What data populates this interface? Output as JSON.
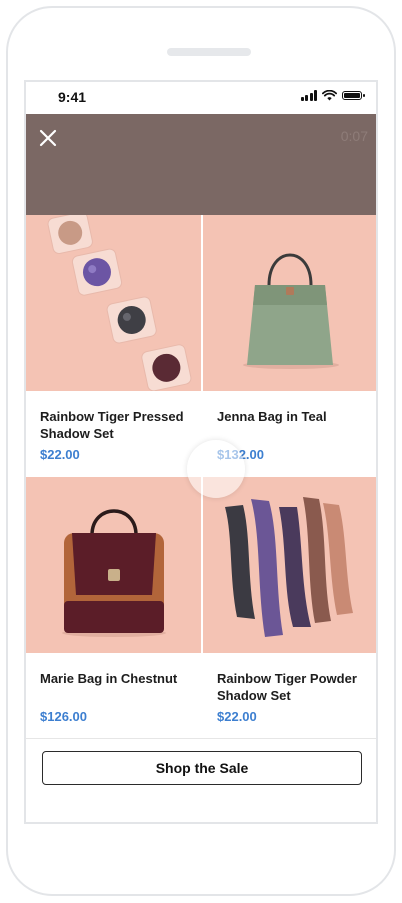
{
  "status_bar": {
    "time": "9:41"
  },
  "video": {
    "timer": "0:07"
  },
  "products": [
    {
      "name": "Rainbow Tiger Pressed Shadow Set",
      "price": "$22.00"
    },
    {
      "name": "Jenna Bag in Teal",
      "price": "$132.00"
    },
    {
      "name": "Marie Bag in Chestnut",
      "price": "$126.00"
    },
    {
      "name": "Rainbow Tiger Powder Shadow Set",
      "price": "$22.00"
    }
  ],
  "cta": {
    "label": "Shop the Sale"
  },
  "colors": {
    "accent_price": "#3d7fd0",
    "header_bg": "#7b6864",
    "product_bg": "#f4c3b4"
  }
}
